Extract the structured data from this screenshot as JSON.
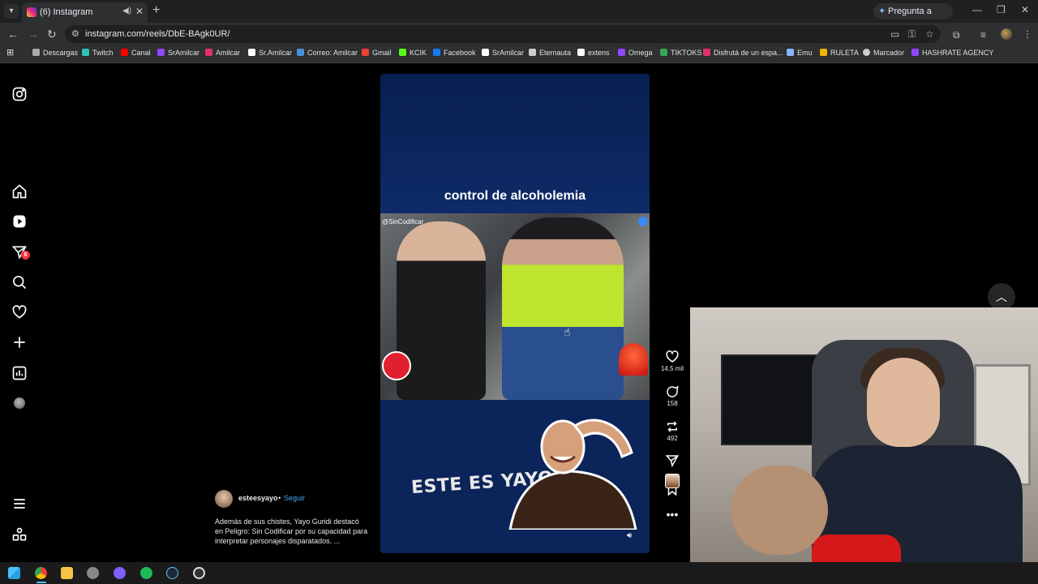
{
  "browser": {
    "tab": {
      "title": "(6) Instagram"
    },
    "gemini_label": "Pregunta a Gemini",
    "url": "instagram.com/reels/DbE-BAgk0UR/",
    "bookmarks": [
      {
        "label": "Descargas",
        "color": "#aaaaaa"
      },
      {
        "label": "Twitch",
        "color": "#2ec4b6"
      },
      {
        "label": "Canal",
        "color": "#ff0000"
      },
      {
        "label": "SrAmilcar",
        "color": "#9146ff"
      },
      {
        "label": "Amilcar",
        "color": "#e1306c"
      },
      {
        "label": "Sr.Amilcar",
        "color": "#ffffff"
      },
      {
        "label": "Correo: Amilcar",
        "color": "#4a90d9"
      },
      {
        "label": "Gmail",
        "color": "#ea4335"
      },
      {
        "label": "KCIK",
        "color": "#53fc18"
      },
      {
        "label": "Facebook",
        "color": "#1877f2"
      },
      {
        "label": "SrAmilcar",
        "color": "#ffffff"
      },
      {
        "label": "Eternauta",
        "color": "#cccccc"
      },
      {
        "label": "extens",
        "color": "#ffffff"
      },
      {
        "label": "Omega",
        "color": "#9146ff"
      },
      {
        "label": "TIKTOKS",
        "color": "#34a853"
      },
      {
        "label": "Disfrutá de un espa...",
        "color": "#e1306c"
      },
      {
        "label": "Emu",
        "color": "#8ab4f8"
      },
      {
        "label": "RULETA",
        "color": "#f4b400"
      },
      {
        "label": "Marcador",
        "color": "#cccccc"
      },
      {
        "label": "HASHRATE AGENCY",
        "color": "#9146ff"
      }
    ]
  },
  "instagram": {
    "notification_count": "6",
    "reel": {
      "overlay_title": "control de alcoholemia",
      "watermark": "@SinCodificar",
      "bottom_text": "ESTE ES YAYO"
    },
    "actions": {
      "likes": "14,5 mil",
      "comments": "158",
      "reposts": "492"
    },
    "caption": {
      "username": "esteesyayo",
      "separator": "•",
      "follow_label": "Seguir",
      "text": "Además de sus chistes, Yayo Guridi destacó en Peligro: Sin Codificar por su capacidad para interpretar personajes disparatados. ..."
    }
  }
}
